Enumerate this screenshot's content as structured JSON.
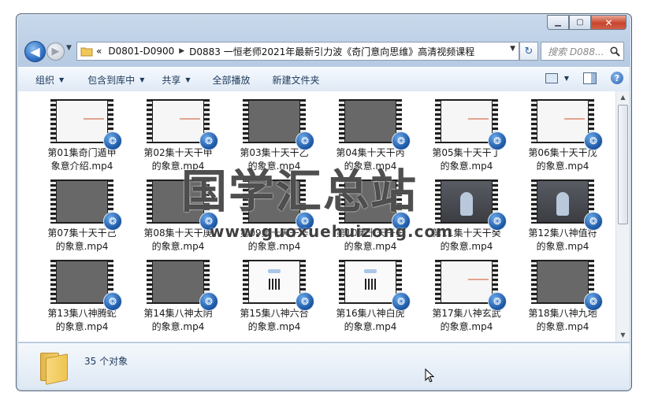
{
  "window": {
    "controls": {
      "minimize": "▁",
      "maximize": "▢",
      "close": "✕"
    }
  },
  "nav": {
    "back_glyph": "◀",
    "forward_glyph": "▶",
    "history_glyph": "▼",
    "breadcrumb_root": "«",
    "breadcrumbs": [
      "D0801-D0900",
      "D0883 一恒老师2021年最新引力波《奇门意向思维》高清视频课程"
    ],
    "crumb_separator": "▶",
    "refresh_glyph": "↻",
    "search_placeholder": "搜索 D088...",
    "search_glyph": "🔍"
  },
  "toolbar": {
    "organize": "组织",
    "include_library": "包含到库中",
    "share": "共享",
    "play_all": "全部播放",
    "new_folder": "新建文件夹",
    "help": "?"
  },
  "files": [
    {
      "name": "第01集奇门遁甲象意介绍.mp4",
      "line1": "第01集奇门遁甲",
      "line2": "象意介绍.mp4",
      "thumb": "white"
    },
    {
      "name": "第02集十天干甲的象意.mp4",
      "line1": "第02集十天干甲",
      "line2": "的象意.mp4",
      "thumb": "white"
    },
    {
      "name": "第03集十天干乙的象意.mp4",
      "line1": "第03集十天干乙",
      "line2": "的象意.mp4",
      "thumb": "gray"
    },
    {
      "name": "第04集十天干丙的象意.mp4",
      "line1": "第04集十天干丙",
      "line2": "的象意.mp4",
      "thumb": "gray"
    },
    {
      "name": "第05集十天干丁的象意.mp4",
      "line1": "第05集十天干丁",
      "line2": "的象意.mp4",
      "thumb": "white"
    },
    {
      "name": "第06集十天干戊的象意.mp4",
      "line1": "第06集十天干戊",
      "line2": "的象意.mp4",
      "thumb": "white"
    },
    {
      "name": "第07集十天干己的象意.mp4",
      "line1": "第07集十天干己",
      "line2": "的象意.mp4",
      "thumb": "gray"
    },
    {
      "name": "第08集十天干庚的象意.mp4",
      "line1": "第08集十天干庚",
      "line2": "的象意.mp4",
      "thumb": "gray"
    },
    {
      "name": "第09集十天干辛的象意.mp4",
      "line1": "第09集十天干辛",
      "line2": "的象意.mp4",
      "thumb": "gray"
    },
    {
      "name": "第10集十天干壬的象意.mp4",
      "line1": "第10集十天干壬",
      "line2": "的象意.mp4",
      "thumb": "gray"
    },
    {
      "name": "第11集十天干癸的象意.mp4",
      "line1": "第11集十天干癸",
      "line2": "的象意.mp4",
      "thumb": "person"
    },
    {
      "name": "第12集八神值符的象意.mp4",
      "line1": "第12集八神值符",
      "line2": "的象意.mp4",
      "thumb": "person"
    },
    {
      "name": "第13集八神腾蛇的象意.mp4",
      "line1": "第13集八神腾蛇",
      "line2": "的象意.mp4",
      "thumb": "gray"
    },
    {
      "name": "第14集八神太阴的象意.mp4",
      "line1": "第14集八神太阴",
      "line2": "的象意.mp4",
      "thumb": "gray"
    },
    {
      "name": "第15集八神六合的象意.mp4",
      "line1": "第15集八神六合",
      "line2": "的象意.mp4",
      "thumb": "logo"
    },
    {
      "name": "第16集八神白虎的象意.mp4",
      "line1": "第16集八神白虎",
      "line2": "的象意.mp4",
      "thumb": "logo"
    },
    {
      "name": "第17集八神玄武的象意.mp4",
      "line1": "第17集八神玄武",
      "line2": "的象意.mp4",
      "thumb": "white"
    },
    {
      "name": "第18集八神九地的象意.mp4",
      "line1": "第18集八神九地",
      "line2": "的象意.mp4",
      "thumb": "gray"
    }
  ],
  "status": {
    "count": "35 个对象"
  },
  "watermark": {
    "title": "国学汇总站",
    "url": "www.guoxuehuizong.com"
  },
  "colors": {
    "accent": "#2f6fc4",
    "close": "#c7452c",
    "toolbar_text": "#1e395b"
  }
}
